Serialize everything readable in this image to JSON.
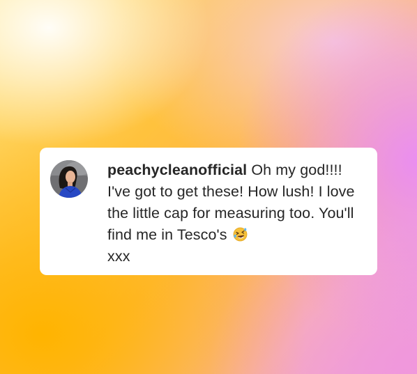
{
  "comment": {
    "username": "peachycleanofficial",
    "body": " Oh my god!!!! I've got to get these! How lush! I love the little cap for measuring too. You'll find me in Tesco's ",
    "trailing": "xxx",
    "emoji": "rolling-on-floor-laughing-emoji"
  },
  "colors": {
    "card_background": "#ffffff",
    "text": "#262626"
  }
}
